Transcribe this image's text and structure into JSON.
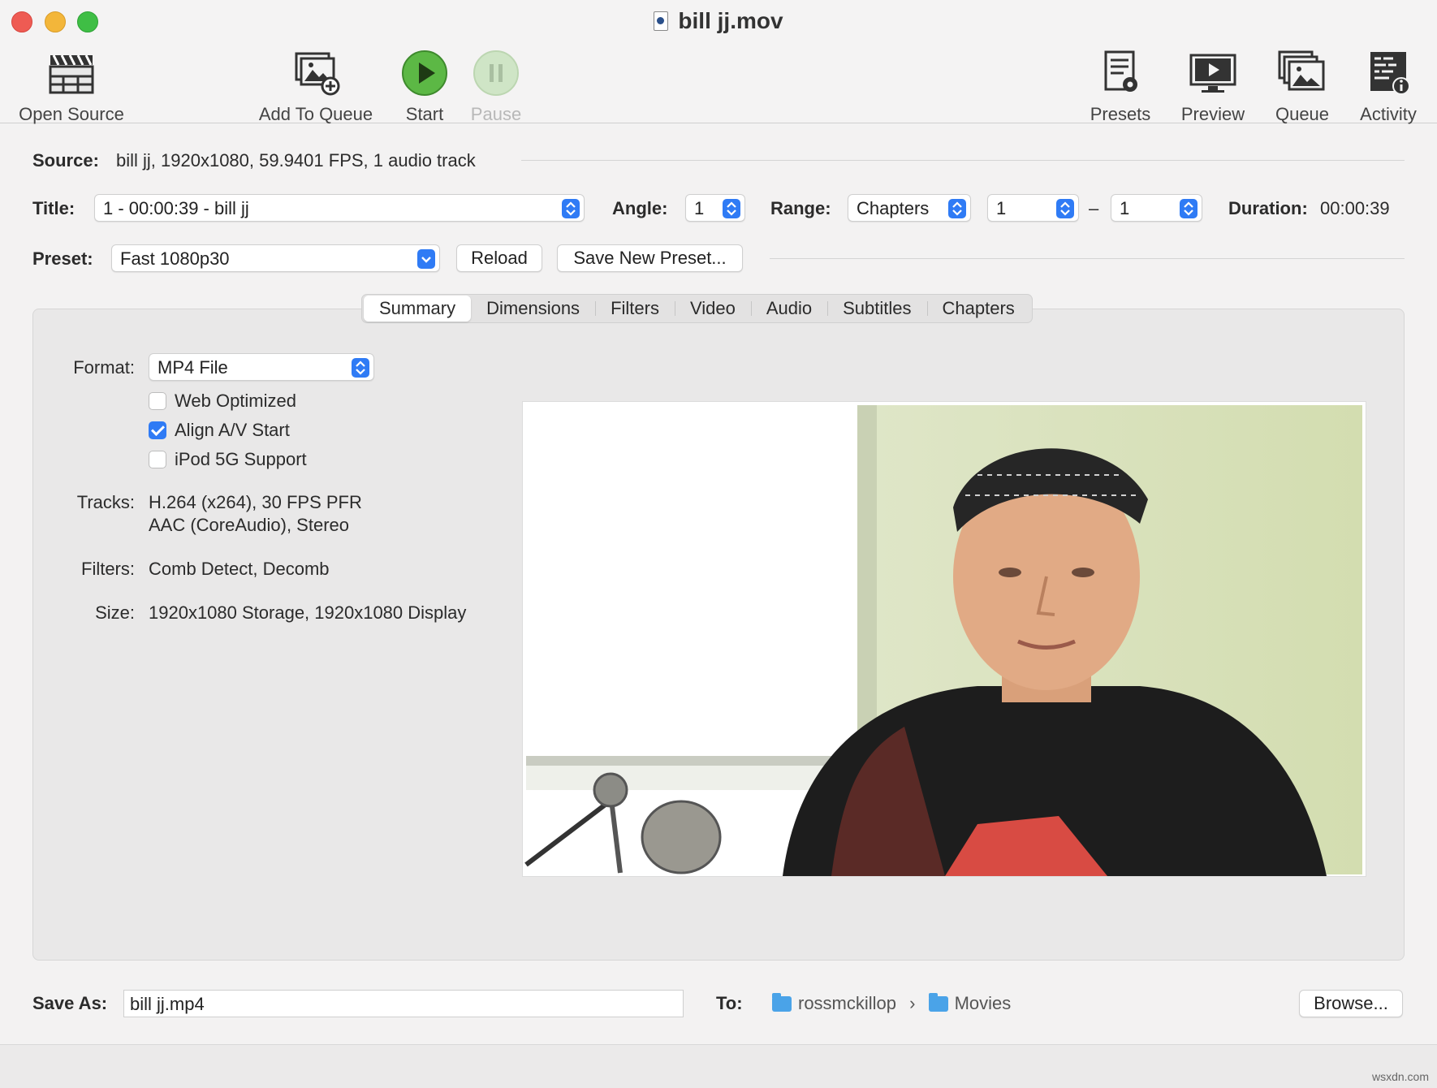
{
  "window": {
    "title": "bill jj.mov"
  },
  "toolbar": {
    "open_source": "Open Source",
    "add_to_queue": "Add To Queue",
    "start": "Start",
    "pause": "Pause",
    "presets": "Presets",
    "preview": "Preview",
    "queue": "Queue",
    "activity": "Activity"
  },
  "source": {
    "label": "Source:",
    "value": "bill jj, 1920x1080, 59.9401 FPS, 1 audio track"
  },
  "title_row": {
    "title_label": "Title:",
    "title_value": "1 - 00:00:39 - bill jj",
    "angle_label": "Angle:",
    "angle_value": "1",
    "range_label": "Range:",
    "range_value": "Chapters",
    "range_start": "1",
    "range_dash": "–",
    "range_end": "1",
    "duration_label": "Duration:",
    "duration_value": "00:00:39"
  },
  "preset_row": {
    "label": "Preset:",
    "value": "Fast 1080p30",
    "reload": "Reload",
    "save_new": "Save New Preset..."
  },
  "tabs": [
    "Summary",
    "Dimensions",
    "Filters",
    "Video",
    "Audio",
    "Subtitles",
    "Chapters"
  ],
  "active_tab": "Summary",
  "summary": {
    "format_label": "Format:",
    "format_value": "MP4 File",
    "web_optimized": {
      "label": "Web Optimized",
      "checked": false
    },
    "align_av": {
      "label": "Align A/V Start",
      "checked": true
    },
    "ipod": {
      "label": "iPod 5G Support",
      "checked": false
    },
    "tracks_label": "Tracks:",
    "tracks_line1": "H.264 (x264), 30 FPS PFR",
    "tracks_line2": "AAC (CoreAudio), Stereo",
    "filters_label": "Filters:",
    "filters_value": "Comb Detect, Decomb",
    "size_label": "Size:",
    "size_value": "1920x1080 Storage, 1920x1080 Display"
  },
  "save": {
    "save_as_label": "Save As:",
    "filename": "bill jj.mp4",
    "to_label": "To:",
    "path_home": "rossmckillop",
    "path_sep": "›",
    "path_folder": "Movies",
    "browse": "Browse..."
  },
  "watermark": "wsxdn.com",
  "colors": {
    "accent": "#2f7bf5",
    "start_green": "#4caf3a"
  }
}
